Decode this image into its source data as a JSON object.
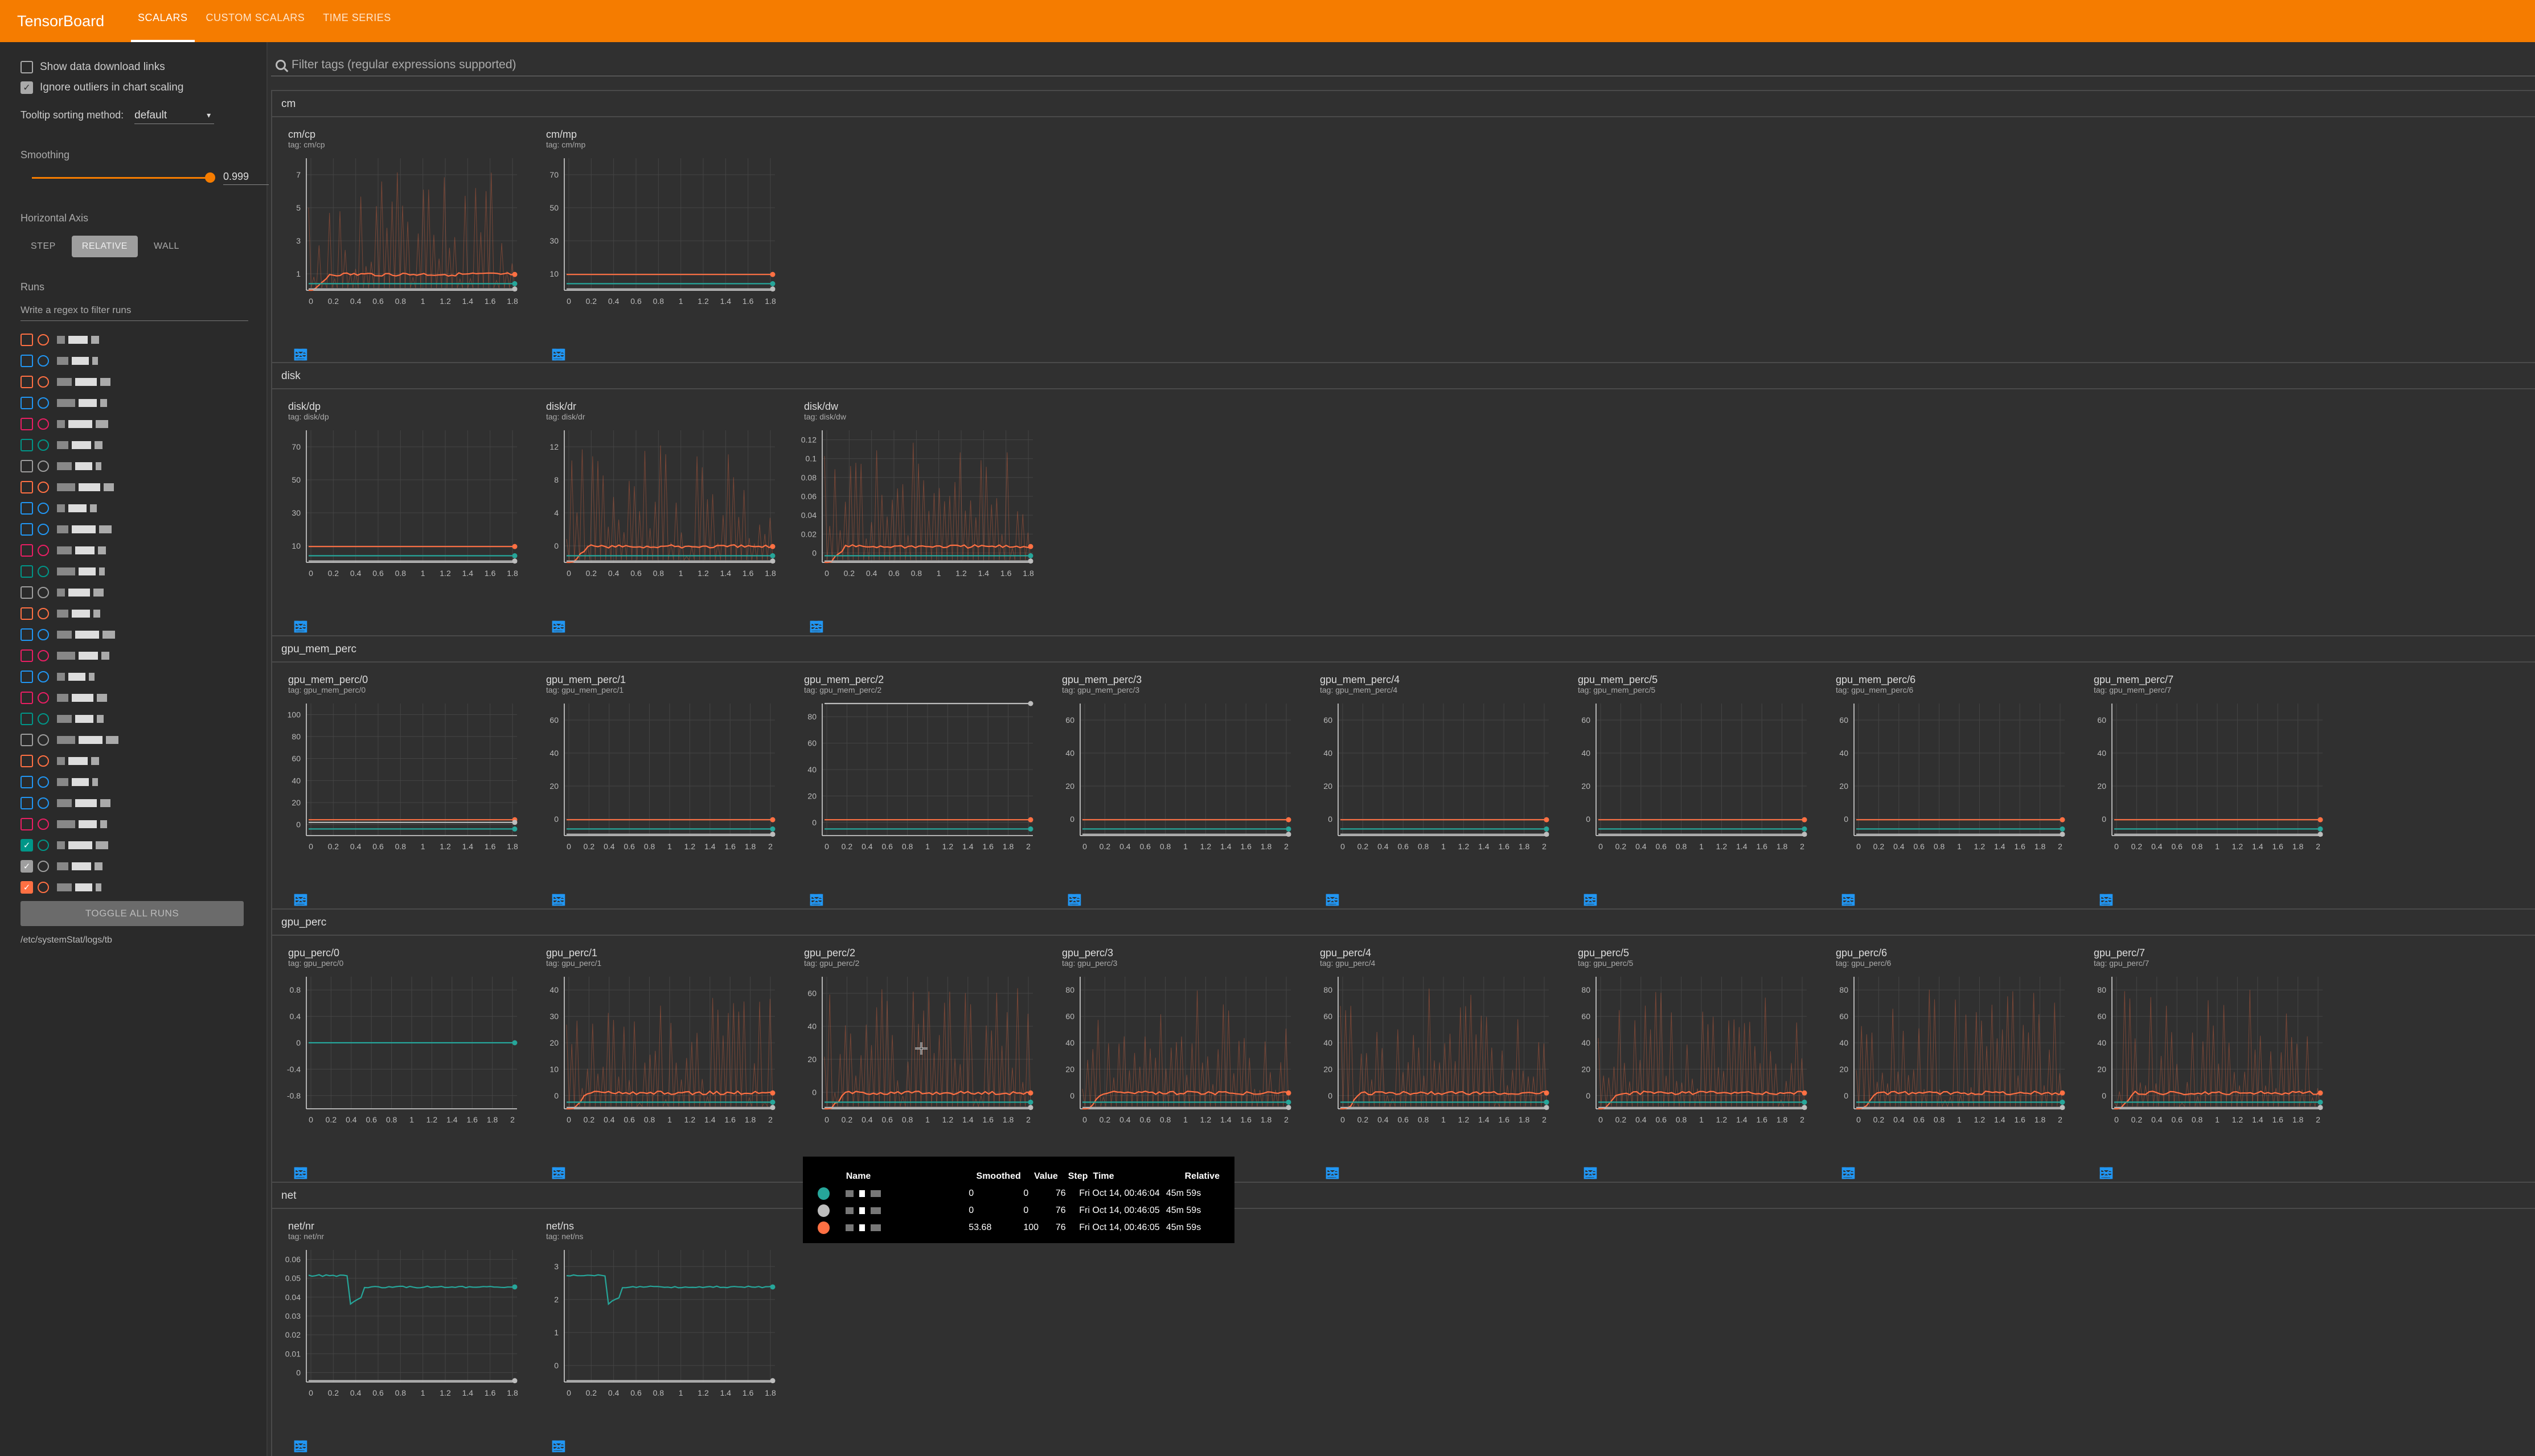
{
  "app": {
    "title": "TensorBoard",
    "tabs": [
      "SCALARS",
      "CUSTOM SCALARS",
      "TIME SERIES"
    ],
    "active_tab": "SCALARS",
    "accent": "#f57c00"
  },
  "sidebar": {
    "show_download_links": "Show data download links",
    "ignore_outliers": "Ignore outliers in chart scaling",
    "tooltip_sort_label": "Tooltip sorting method:",
    "tooltip_sort_value": "default",
    "smoothing_label": "Smoothing",
    "smoothing_value": "0.999",
    "smoothing_fraction": 0.999,
    "horizontal_axis_label": "Horizontal Axis",
    "axis_options": [
      "STEP",
      "RELATIVE",
      "WALL"
    ],
    "axis_selected": "RELATIVE",
    "runs_label": "Runs",
    "runs_filter_placeholder": "Write a regex to filter runs",
    "toggle_all": "TOGGLE ALL RUNS",
    "logdir": "/etc/systemStat/logs/tb"
  },
  "filter_placeholder": "Filter tags (regular expressions supported)",
  "groups": [
    {
      "name": "cm",
      "charts": [
        {
          "title": "cm/cp",
          "tag": "tag: cm/cp",
          "yticks": [
            "1",
            "3",
            "5",
            "7"
          ],
          "xticks": [
            "0",
            "0.2",
            "0.4",
            "0.6",
            "0.8",
            "1",
            "1.2",
            "1.4",
            "1.6",
            "1.8"
          ]
        },
        {
          "title": "cm/mp",
          "tag": "tag: cm/mp",
          "yticks": [
            "10",
            "30",
            "50",
            "70"
          ],
          "xticks": [
            "0",
            "0.2",
            "0.4",
            "0.6",
            "0.8",
            "1",
            "1.2",
            "1.4",
            "1.6",
            "1.8"
          ]
        }
      ]
    },
    {
      "name": "disk",
      "charts": [
        {
          "title": "disk/dp",
          "tag": "tag: disk/dp",
          "yticks": [
            "10",
            "30",
            "50",
            "70"
          ],
          "xticks": [
            "0",
            "0.2",
            "0.4",
            "0.6",
            "0.8",
            "1",
            "1.2",
            "1.4",
            "1.6",
            "1.8"
          ]
        },
        {
          "title": "disk/dr",
          "tag": "tag: disk/dr",
          "yticks": [
            "0",
            "4",
            "8",
            "12"
          ],
          "xticks": [
            "0",
            "0.2",
            "0.4",
            "0.6",
            "0.8",
            "1",
            "1.2",
            "1.4",
            "1.6",
            "1.8"
          ]
        },
        {
          "title": "disk/dw",
          "tag": "tag: disk/dw",
          "yticks": [
            "0",
            "0.02",
            "0.04",
            "0.06",
            "0.08",
            "0.1",
            "0.12"
          ],
          "xticks": [
            "0",
            "0.2",
            "0.4",
            "0.6",
            "0.8",
            "1",
            "1.2",
            "1.4",
            "1.6",
            "1.8"
          ]
        }
      ]
    },
    {
      "name": "gpu_mem_perc",
      "charts": [
        {
          "title": "gpu_mem_perc/0",
          "tag": "tag: gpu_mem_perc/0",
          "yticks": [
            "0",
            "20",
            "40",
            "60",
            "80",
            "100"
          ],
          "xticks": [
            "0",
            "0.2",
            "0.4",
            "0.6",
            "0.8",
            "1",
            "1.2",
            "1.4",
            "1.6",
            "1.8"
          ]
        },
        {
          "title": "gpu_mem_perc/1",
          "tag": "tag: gpu_mem_perc/1",
          "yticks": [
            "0",
            "20",
            "40",
            "60"
          ],
          "xticks": [
            "0",
            "0.2",
            "0.4",
            "0.6",
            "0.8",
            "1",
            "1.2",
            "1.4",
            "1.6",
            "1.8",
            "2"
          ]
        },
        {
          "title": "gpu_mem_perc/2",
          "tag": "tag: gpu_mem_perc/2",
          "yticks": [
            "0",
            "20",
            "40",
            "60",
            "80"
          ],
          "xticks": [
            "0",
            "0.2",
            "0.4",
            "0.6",
            "0.8",
            "1",
            "1.2",
            "1.4",
            "1.6",
            "1.8",
            "2"
          ]
        },
        {
          "title": "gpu_mem_perc/3",
          "tag": "tag: gpu_mem_perc/3",
          "yticks": [
            "0",
            "20",
            "40",
            "60"
          ],
          "xticks": [
            "0",
            "0.2",
            "0.4",
            "0.6",
            "0.8",
            "1",
            "1.2",
            "1.4",
            "1.6",
            "1.8",
            "2"
          ]
        },
        {
          "title": "gpu_mem_perc/4",
          "tag": "tag: gpu_mem_perc/4",
          "yticks": [
            "0",
            "20",
            "40",
            "60"
          ],
          "xticks": [
            "0",
            "0.2",
            "0.4",
            "0.6",
            "0.8",
            "1",
            "1.2",
            "1.4",
            "1.6",
            "1.8",
            "2"
          ]
        },
        {
          "title": "gpu_mem_perc/5",
          "tag": "tag: gpu_mem_perc/5",
          "yticks": [
            "0",
            "20",
            "40",
            "60"
          ],
          "xticks": [
            "0",
            "0.2",
            "0.4",
            "0.6",
            "0.8",
            "1",
            "1.2",
            "1.4",
            "1.6",
            "1.8",
            "2"
          ]
        },
        {
          "title": "gpu_mem_perc/6",
          "tag": "tag: gpu_mem_perc/6",
          "yticks": [
            "0",
            "20",
            "40",
            "60"
          ],
          "xticks": [
            "0",
            "0.2",
            "0.4",
            "0.6",
            "0.8",
            "1",
            "1.2",
            "1.4",
            "1.6",
            "1.8",
            "2"
          ]
        },
        {
          "title": "gpu_mem_perc/7",
          "tag": "tag: gpu_mem_perc/7",
          "yticks": [
            "0",
            "20",
            "40",
            "60"
          ],
          "xticks": [
            "0",
            "0.2",
            "0.4",
            "0.6",
            "0.8",
            "1",
            "1.2",
            "1.4",
            "1.6",
            "1.8",
            "2"
          ]
        }
      ]
    },
    {
      "name": "gpu_perc",
      "charts": [
        {
          "title": "gpu_perc/0",
          "tag": "tag: gpu_perc/0",
          "yticks": [
            "-0.8",
            "-0.4",
            "0",
            "0.4",
            "0.8"
          ],
          "xticks": [
            "0",
            "0.2",
            "0.4",
            "0.6",
            "0.8",
            "1",
            "1.2",
            "1.4",
            "1.6",
            "1.8",
            "2"
          ]
        },
        {
          "title": "gpu_perc/1",
          "tag": "tag: gpu_perc/1",
          "yticks": [
            "0",
            "10",
            "20",
            "30",
            "40"
          ],
          "xticks": [
            "0",
            "0.2",
            "0.4",
            "0.6",
            "0.8",
            "1",
            "1.2",
            "1.4",
            "1.6",
            "1.8",
            "2"
          ]
        },
        {
          "title": "gpu_perc/2",
          "tag": "tag: gpu_perc/2",
          "yticks": [
            "0",
            "20",
            "40",
            "60"
          ],
          "xticks": [
            "0",
            "0.2",
            "0.4",
            "0.6",
            "0.8",
            "1",
            "1.2",
            "1.4",
            "1.6",
            "1.8",
            "2"
          ]
        },
        {
          "title": "gpu_perc/3",
          "tag": "tag: gpu_perc/3",
          "yticks": [
            "0",
            "20",
            "40",
            "60",
            "80"
          ],
          "xticks": [
            "0",
            "0.2",
            "0.4",
            "0.6",
            "0.8",
            "1",
            "1.2",
            "1.4",
            "1.6",
            "1.8",
            "2"
          ]
        },
        {
          "title": "gpu_perc/4",
          "tag": "tag: gpu_perc/4",
          "yticks": [
            "0",
            "20",
            "40",
            "60",
            "80"
          ],
          "xticks": [
            "0",
            "0.2",
            "0.4",
            "0.6",
            "0.8",
            "1",
            "1.2",
            "1.4",
            "1.6",
            "1.8",
            "2"
          ]
        },
        {
          "title": "gpu_perc/5",
          "tag": "tag: gpu_perc/5",
          "yticks": [
            "0",
            "20",
            "40",
            "60",
            "80"
          ],
          "xticks": [
            "0",
            "0.2",
            "0.4",
            "0.6",
            "0.8",
            "1",
            "1.2",
            "1.4",
            "1.6",
            "1.8",
            "2"
          ]
        },
        {
          "title": "gpu_perc/6",
          "tag": "tag: gpu_perc/6",
          "yticks": [
            "0",
            "20",
            "40",
            "60",
            "80"
          ],
          "xticks": [
            "0",
            "0.2",
            "0.4",
            "0.6",
            "0.8",
            "1",
            "1.2",
            "1.4",
            "1.6",
            "1.8",
            "2"
          ]
        },
        {
          "title": "gpu_perc/7",
          "tag": "tag: gpu_perc/7",
          "yticks": [
            "0",
            "20",
            "40",
            "60",
            "80"
          ],
          "xticks": [
            "0",
            "0.2",
            "0.4",
            "0.6",
            "0.8",
            "1",
            "1.2",
            "1.4",
            "1.6",
            "1.8",
            "2"
          ]
        }
      ]
    },
    {
      "name": "net",
      "charts": [
        {
          "title": "net/nr",
          "tag": "tag: net/nr",
          "yticks": [
            "0",
            "0.01",
            "0.02",
            "0.03",
            "0.04",
            "0.05",
            "0.06"
          ],
          "xticks": [
            "0",
            "0.2",
            "0.4",
            "0.6",
            "0.8",
            "1",
            "1.2",
            "1.4",
            "1.6",
            "1.8"
          ]
        },
        {
          "title": "net/ns",
          "tag": "tag: net/ns",
          "yticks": [
            "0",
            "1",
            "2",
            "3"
          ],
          "xticks": [
            "0",
            "0.2",
            "0.4",
            "0.6",
            "0.8",
            "1",
            "1.2",
            "1.4",
            "1.6",
            "1.8"
          ]
        }
      ]
    }
  ],
  "tooltip": {
    "headers": [
      "Name",
      "Smoothed",
      "Value",
      "Step",
      "Time",
      "Relative"
    ],
    "rows": [
      {
        "color": "#26a69a",
        "smoothed": "0",
        "value": "0",
        "step": "76",
        "time": "Fri Oct 14, 00:46:04",
        "relative": "45m 59s"
      },
      {
        "color": "#bdbdbd",
        "smoothed": "0",
        "value": "0",
        "step": "76",
        "time": "Fri Oct 14, 00:46:05",
        "relative": "45m 59s"
      },
      {
        "color": "#ff7043",
        "smoothed": "53.68",
        "value": "100",
        "step": "76",
        "time": "Fri Oct 14, 00:46:05",
        "relative": "45m 59s"
      }
    ]
  },
  "colors": {
    "orange": "#ff7043",
    "teal": "#26a69a",
    "grey": "#bdbdbd",
    "blue": "#2196f3"
  }
}
